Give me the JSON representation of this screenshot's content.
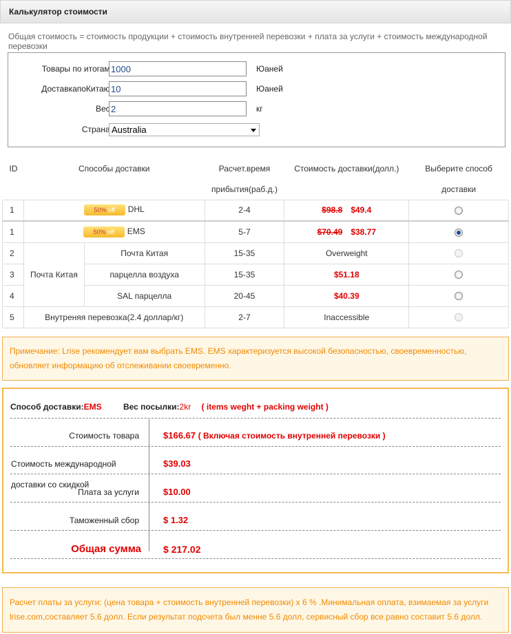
{
  "header": {
    "title": "Калькулятор стоимости"
  },
  "formula": "Общая стоимость = стоимость продукции + стоимость внутренней перевозки + плата за услуги + стоимость международной перевозки",
  "form": {
    "goods_label": "Товары по итогам:",
    "goods_value": "1000",
    "goods_unit": "Юаней",
    "delivery_label": "ДоставкапоКитаю:",
    "delivery_value": "10",
    "delivery_unit": "Юаней",
    "weight_label": "Вес:",
    "weight_value": "2",
    "weight_unit": "кг",
    "country_label": "Страна:",
    "country_value": "Australia"
  },
  "table": {
    "headers": {
      "id": "ID",
      "method": "Способы доставки",
      "time1": "Расчет.время",
      "time2": "прибытия(раб.д.)",
      "cost": "Стоимость доставки(долл.)",
      "select1": "Выберите способ",
      "select2": "доставки"
    },
    "rows": [
      {
        "id": "1",
        "badge": "50%",
        "badge_off": "off",
        "name": "DHL",
        "time": "2-4",
        "old": "$98.8",
        "new": "$49.4"
      },
      {
        "id": "1",
        "badge": "50%",
        "badge_off": "off",
        "name": "EMS",
        "time": "5-7",
        "old": "$70.49",
        "new": "$38.77"
      },
      {
        "id": "2",
        "group": "Почта Китая",
        "name": "Почта Китая",
        "time": "15-35",
        "cost": "Overweight"
      },
      {
        "id": "3",
        "name": "парцелла воздуха",
        "time": "15-35",
        "cost": "$51.18"
      },
      {
        "id": "4",
        "name": "SAL парцелла",
        "time": "20-45",
        "cost": "$40.39"
      },
      {
        "id": "5",
        "name": "Внутреняя перевозка(2.4 доллар/кг)",
        "time": "2-7",
        "cost": "Inaccessible"
      }
    ]
  },
  "note": "Примечание: Lrise рекомендует вам выбрать EMS. EMS характеризуется высокой безопасностью, своевременностью, обновляет информацию об отслеживании своевременно.",
  "summary": {
    "method_label": "Способ доставки:",
    "method_value": "EMS",
    "weight_label": "Вес посылки:",
    "weight_value": "2kr",
    "weight_note": "( items weght + packing weight )",
    "goods_label": "Стоимость товара",
    "goods_value": "$166.67",
    "goods_note": "( Включая стоимость внутренней перевозки )",
    "intl_label1": "Стоимость международной",
    "intl_label2": "доставки со скидкой",
    "intl_value": "$39.03",
    "service_label": "Плата за услуги",
    "service_value": "$10.00",
    "customs_label": "Таможенный сбор",
    "customs_value": "$ 1.32",
    "total_label": "Общая сумма",
    "total_value": "$ 217.02"
  },
  "footer": "Расчет платы за услуги: (цена товара + стоимость внутренней перевозки) x 6 % .Минимальная оплата, взимаемая за услуги lrise.com,составляет 5.6 долл. Если результат подсчета был менне 5.6 долл, сервисный сбор все равно составит 5.6 долл."
}
